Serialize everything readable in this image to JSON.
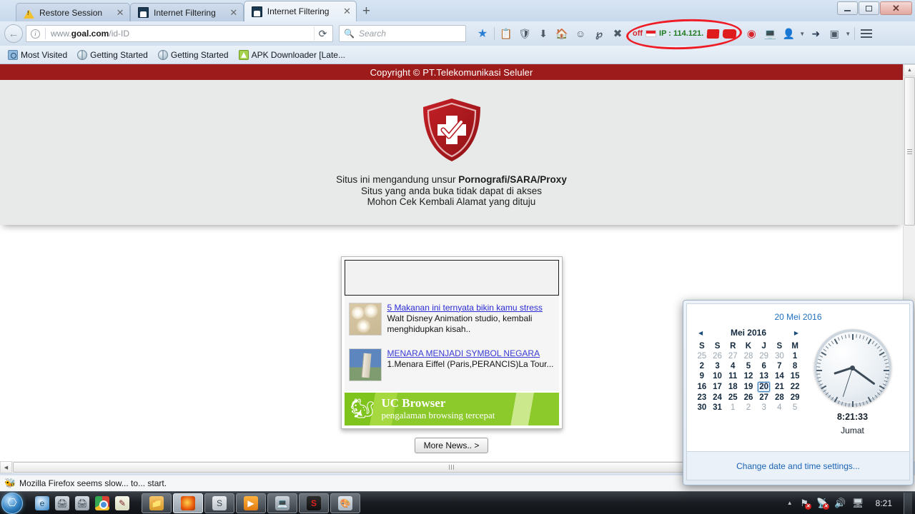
{
  "window": {
    "controls": {
      "minimize": "–",
      "maximize": "❐",
      "close": "✕"
    }
  },
  "tabs": [
    {
      "title": "Restore Session",
      "icon": "warning-icon",
      "active": false,
      "close": "✕"
    },
    {
      "title": "Internet Filtering",
      "icon": "page-icon",
      "active": false,
      "close": "✕"
    },
    {
      "title": "Internet Filtering",
      "icon": "page-icon",
      "active": true,
      "close": "✕"
    }
  ],
  "newtab_label": "+",
  "navbar": {
    "back_glyph": "←",
    "url_prefix": "www.",
    "url_domain": "goal.com",
    "url_path": "/id-ID",
    "reload_glyph": "⟳",
    "search_placeholder": "Search",
    "search_value": "",
    "ip_indicator": {
      "status": "off",
      "flag": "indonesia-flag",
      "label": "IP : 114.121.",
      "redacted": true
    },
    "icons": [
      "bookmark-star-icon",
      "library-icon",
      "shield-icon",
      "download-icon",
      "home-icon",
      "smiley-icon",
      "pocket-icon",
      "close-x-icon"
    ],
    "right_icons": [
      "opera-icon",
      "screen-icon",
      "avatar-icon",
      "pointer-icon",
      "crop-icon"
    ],
    "menu_glyph": "hamburger-icon"
  },
  "bookmarks": [
    {
      "label": "Most Visited",
      "icon": "most-visited-icon"
    },
    {
      "label": "Getting Started",
      "icon": "globe-icon"
    },
    {
      "label": "Getting Started",
      "icon": "globe-icon"
    },
    {
      "label": "APK Downloader [Late...",
      "icon": "apk-icon"
    }
  ],
  "page": {
    "copyright": "Copyright © PT.Telekomunikasi Seluler",
    "shield": "red-shield-check-icon",
    "block_line1_prefix": "Situs ini mengandung unsur ",
    "block_line1_bold": "Pornografi/SARA/Proxy",
    "block_line2": "Situs yang anda buka tidak dapat di akses",
    "block_line3": "Mohon Cek Kembali Alamat yang dituju",
    "news": {
      "items": [
        {
          "thumb": "donuts-thumbnail",
          "link": "5 Makanan ini ternyata bikin kamu stress",
          "desc": "Walt Disney Animation studio, kembali menghidupkan kisah.."
        },
        {
          "thumb": "pisa-tower-thumbnail",
          "link": "MENARA MENJADI SYMBOL NEGARA",
          "desc": "1.Menara Eiffel (Paris,PERANCIS)La Tour..."
        }
      ],
      "banner": {
        "logo": "uc-squirrel-icon",
        "title": "UC Browser",
        "subtitle": "pengalaman browsing tercepat"
      },
      "more_button": "More News.. >"
    }
  },
  "status_bar": {
    "icon": "firefox-slow-icon",
    "text": "Mozilla Firefox seems slow... to... start."
  },
  "clock_flyout": {
    "header_date": "20 Mei 2016",
    "prev_glyph": "◀",
    "next_glyph": "▶",
    "month_label": "Mei 2016",
    "weekdays": [
      "S",
      "S",
      "R",
      "K",
      "J",
      "S",
      "M"
    ],
    "weeks": [
      [
        {
          "d": "25",
          "out": true
        },
        {
          "d": "26",
          "out": true
        },
        {
          "d": "27",
          "out": true
        },
        {
          "d": "28",
          "out": true
        },
        {
          "d": "29",
          "out": true
        },
        {
          "d": "30",
          "out": true
        },
        {
          "d": "1",
          "out": false
        }
      ],
      [
        {
          "d": "2",
          "out": false
        },
        {
          "d": "3",
          "out": false
        },
        {
          "d": "4",
          "out": false
        },
        {
          "d": "5",
          "out": false
        },
        {
          "d": "6",
          "out": false
        },
        {
          "d": "7",
          "out": false
        },
        {
          "d": "8",
          "out": false
        }
      ],
      [
        {
          "d": "9",
          "out": false
        },
        {
          "d": "10",
          "out": false
        },
        {
          "d": "11",
          "out": false
        },
        {
          "d": "12",
          "out": false
        },
        {
          "d": "13",
          "out": false
        },
        {
          "d": "14",
          "out": false
        },
        {
          "d": "15",
          "out": false
        }
      ],
      [
        {
          "d": "16",
          "out": false
        },
        {
          "d": "17",
          "out": false
        },
        {
          "d": "18",
          "out": false
        },
        {
          "d": "19",
          "out": false
        },
        {
          "d": "20",
          "out": false,
          "today": true
        },
        {
          "d": "21",
          "out": false
        },
        {
          "d": "22",
          "out": false
        }
      ],
      [
        {
          "d": "23",
          "out": false
        },
        {
          "d": "24",
          "out": false
        },
        {
          "d": "25",
          "out": false
        },
        {
          "d": "26",
          "out": false
        },
        {
          "d": "27",
          "out": false
        },
        {
          "d": "28",
          "out": false
        },
        {
          "d": "29",
          "out": false
        }
      ],
      [
        {
          "d": "30",
          "out": false
        },
        {
          "d": "31",
          "out": false
        },
        {
          "d": "1",
          "out": true
        },
        {
          "d": "2",
          "out": true
        },
        {
          "d": "3",
          "out": true
        },
        {
          "d": "4",
          "out": true
        },
        {
          "d": "5",
          "out": true
        }
      ]
    ],
    "time": "8:21:33",
    "day_name": "Jumat",
    "settings_link": "Change date and time settings...",
    "clock_hands": {
      "hour_deg": 252,
      "minute_deg": 126,
      "second_deg": 198
    }
  },
  "taskbar": {
    "start": "windows-start-orb",
    "quicklaunch": [
      "ie-icon",
      "printer-icon",
      "printer-icon",
      "chrome-icon",
      "notepad-icon"
    ],
    "tasks": [
      {
        "icon": "folder-icon",
        "active": false
      },
      {
        "icon": "firefox-icon",
        "active": true
      },
      {
        "icon": "snipping-tool-icon",
        "active": false
      },
      {
        "icon": "media-player-icon",
        "active": false
      },
      {
        "icon": "monitor-icon",
        "active": false
      },
      {
        "icon": "s-app-icon",
        "active": false
      },
      {
        "icon": "paint-icon",
        "active": false
      }
    ],
    "tray": {
      "expand": "▲",
      "icons": [
        "flag-error-icon",
        "network-error-icon",
        "volume-icon",
        "display-icon"
      ],
      "time": "8:21"
    }
  },
  "colors": {
    "banner_red": "#9e1b1b",
    "annotation_red": "#ee1c25",
    "link_blue": "#2b2bd4",
    "uc_green": "#8cc92b"
  }
}
